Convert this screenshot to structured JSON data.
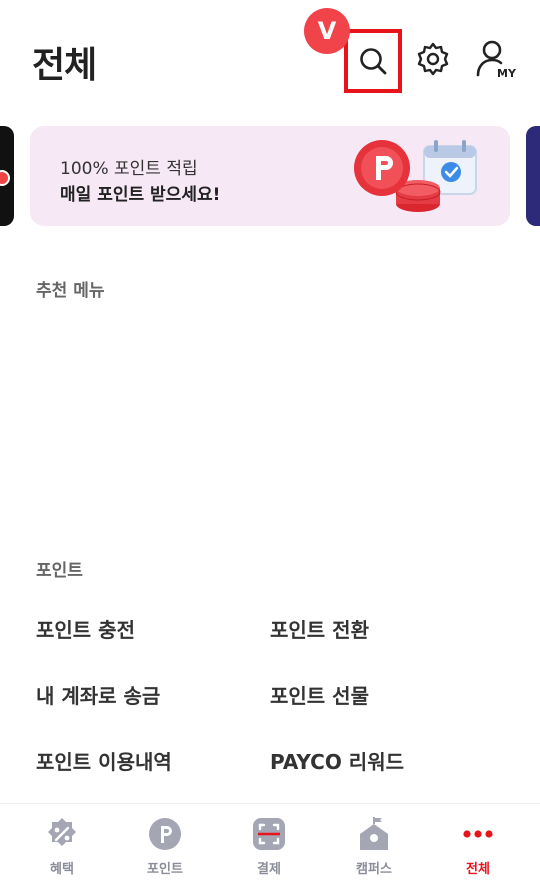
{
  "header": {
    "title": "전체",
    "badge": "V",
    "icons": [
      "search-icon",
      "gear-icon",
      "my-profile-icon"
    ]
  },
  "banner": {
    "line1": "100% 포인트 적립",
    "line2": "매일 포인트 받으세요!",
    "accent_color": "#f6e8f5"
  },
  "sections": {
    "recommended": {
      "label": "추천 메뉴"
    },
    "point": {
      "label": "포인트",
      "items": [
        "포인트 충전",
        "포인트 전환",
        "내 계좌로 송금",
        "포인트 선물",
        "포인트 이용내역",
        "PAYCO 리워드"
      ]
    }
  },
  "tabbar": {
    "tabs": [
      {
        "label": "혜택",
        "icon": "percent-badge-icon"
      },
      {
        "label": "포인트",
        "icon": "point-coin-icon"
      },
      {
        "label": "결제",
        "icon": "scan-icon"
      },
      {
        "label": "캠퍼스",
        "icon": "campus-icon"
      },
      {
        "label": "전체",
        "icon": "more-dots-icon",
        "active": true
      }
    ],
    "active_color": "#e8141c",
    "inactive_color": "#8b8d9a"
  }
}
